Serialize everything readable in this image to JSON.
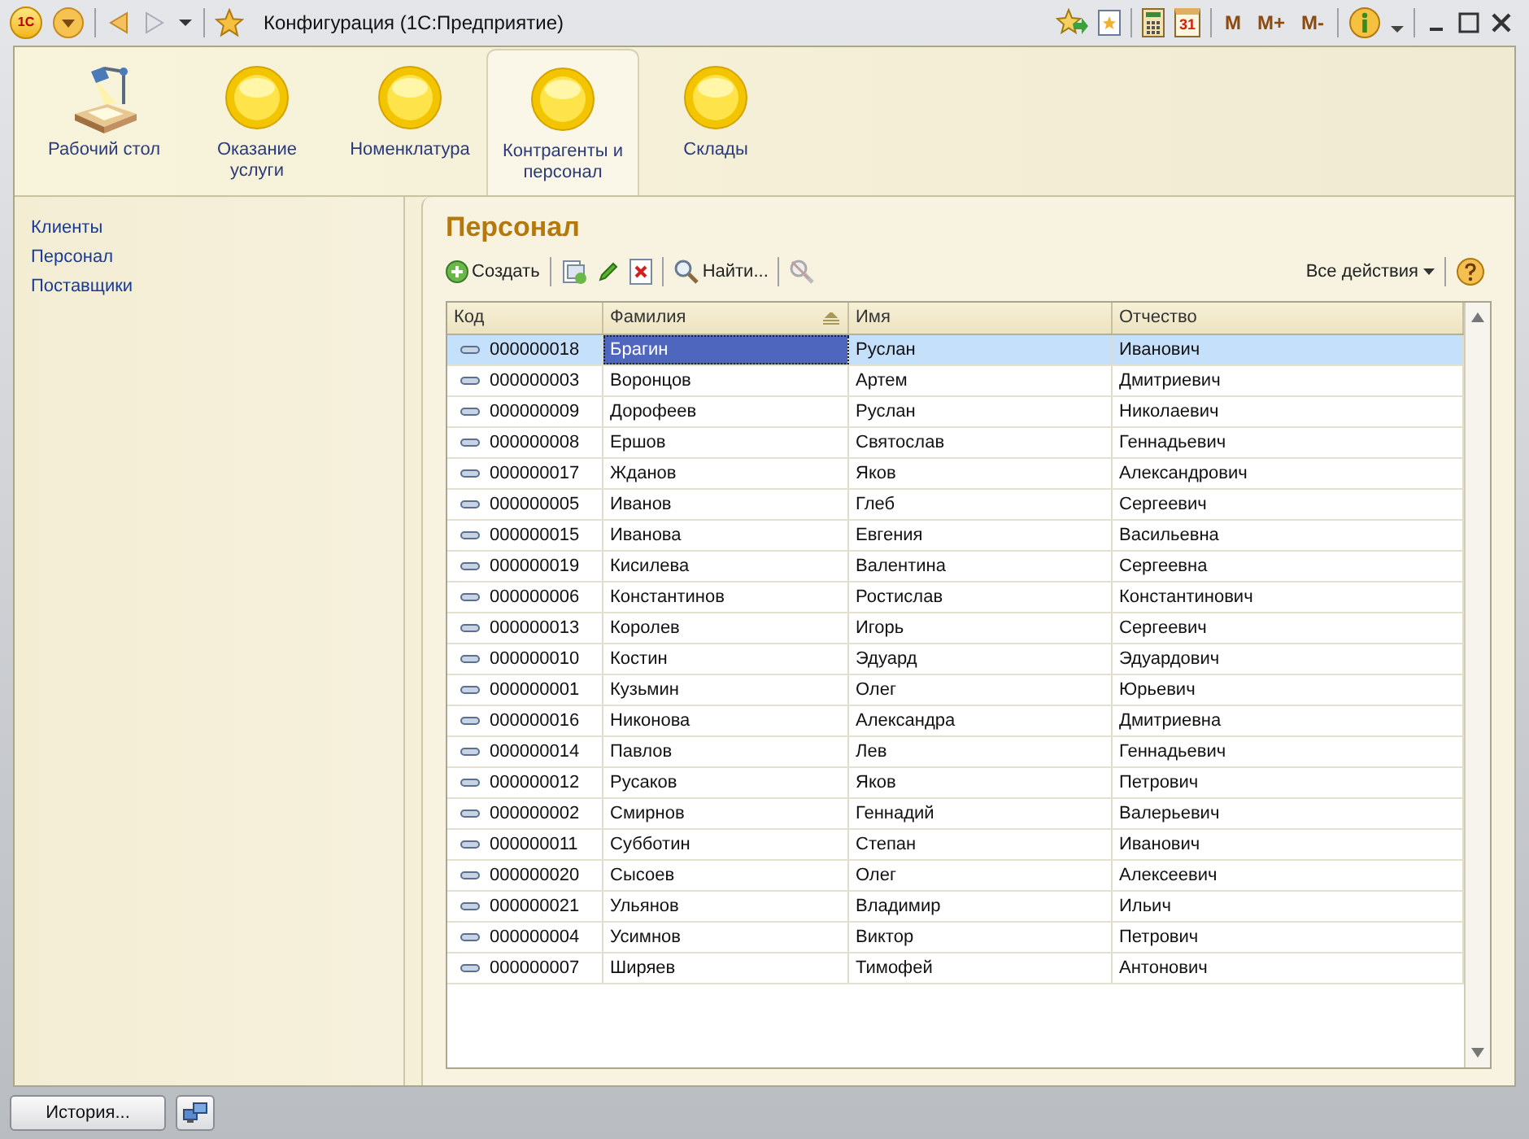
{
  "window": {
    "logo": "1С",
    "title": "Конфигурация  (1С:Предприятие)",
    "calendar_day": "31",
    "memory_buttons": [
      "M",
      "M+",
      "M-"
    ]
  },
  "sections": [
    {
      "label": "Рабочий стол",
      "kind": "desk",
      "selected": false
    },
    {
      "label": "Оказание услуги",
      "kind": "circle",
      "selected": false
    },
    {
      "label": "Номенклатура",
      "kind": "circle",
      "selected": false
    },
    {
      "label": "Контрагенты и персонал",
      "kind": "circle",
      "selected": true
    },
    {
      "label": "Склады",
      "kind": "circle",
      "selected": false
    }
  ],
  "navigation": [
    "Клиенты",
    "Персонал",
    "Поставщики"
  ],
  "form": {
    "title": "Персонал",
    "create_label": "Создать",
    "find_label": "Найти...",
    "all_actions": "Все действия"
  },
  "table": {
    "columns": [
      {
        "label": "Код",
        "sorted": false,
        "current": false
      },
      {
        "label": "Фамилия",
        "sorted": true,
        "current": true
      },
      {
        "label": "Имя",
        "sorted": false,
        "current": false
      },
      {
        "label": "Отчество",
        "sorted": false,
        "current": false
      }
    ],
    "rows": [
      {
        "cells": [
          "000000018",
          "Брагин",
          "Руслан",
          "Иванович"
        ],
        "selected": true
      },
      {
        "cells": [
          "000000003",
          "Воронцов",
          "Артем",
          "Дмитриевич"
        ],
        "selected": false
      },
      {
        "cells": [
          "000000009",
          "Дорофеев",
          "Руслан",
          "Николаевич"
        ],
        "selected": false
      },
      {
        "cells": [
          "000000008",
          "Ершов",
          "Святослав",
          "Геннадьевич"
        ],
        "selected": false
      },
      {
        "cells": [
          "000000017",
          "Жданов",
          "Яков",
          "Александрович"
        ],
        "selected": false
      },
      {
        "cells": [
          "000000005",
          "Иванов",
          "Глеб",
          "Сергеевич"
        ],
        "selected": false
      },
      {
        "cells": [
          "000000015",
          "Иванова",
          "Евгения",
          "Васильевна"
        ],
        "selected": false
      },
      {
        "cells": [
          "000000019",
          "Кисилева",
          "Валентина",
          "Сергеевна"
        ],
        "selected": false
      },
      {
        "cells": [
          "000000006",
          "Константинов",
          "Ростислав",
          "Константинович"
        ],
        "selected": false
      },
      {
        "cells": [
          "000000013",
          "Королев",
          "Игорь",
          "Сергеевич"
        ],
        "selected": false
      },
      {
        "cells": [
          "000000010",
          "Костин",
          "Эдуард",
          "Эдуардович"
        ],
        "selected": false
      },
      {
        "cells": [
          "000000001",
          "Кузьмин",
          "Олег",
          "Юрьевич"
        ],
        "selected": false
      },
      {
        "cells": [
          "000000016",
          "Никонова",
          "Александра",
          "Дмитриевна"
        ],
        "selected": false
      },
      {
        "cells": [
          "000000014",
          "Павлов",
          "Лев",
          "Геннадьевич"
        ],
        "selected": false
      },
      {
        "cells": [
          "000000012",
          "Русаков",
          "Яков",
          "Петрович"
        ],
        "selected": false
      },
      {
        "cells": [
          "000000002",
          "Смирнов",
          "Геннадий",
          "Валерьевич"
        ],
        "selected": false
      },
      {
        "cells": [
          "000000011",
          "Субботин",
          "Степан",
          "Иванович"
        ],
        "selected": false
      },
      {
        "cells": [
          "000000020",
          "Сысоев",
          "Олег",
          "Алексеевич"
        ],
        "selected": false
      },
      {
        "cells": [
          "000000021",
          "Ульянов",
          "Владимир",
          "Ильич"
        ],
        "selected": false
      },
      {
        "cells": [
          "000000004",
          "Усимнов",
          "Виктор",
          "Петрович"
        ],
        "selected": false
      },
      {
        "cells": [
          "000000007",
          "Ширяев",
          "Тимофей",
          "Антонович"
        ],
        "selected": false
      }
    ]
  },
  "status_bar": {
    "history_button": "История..."
  }
}
